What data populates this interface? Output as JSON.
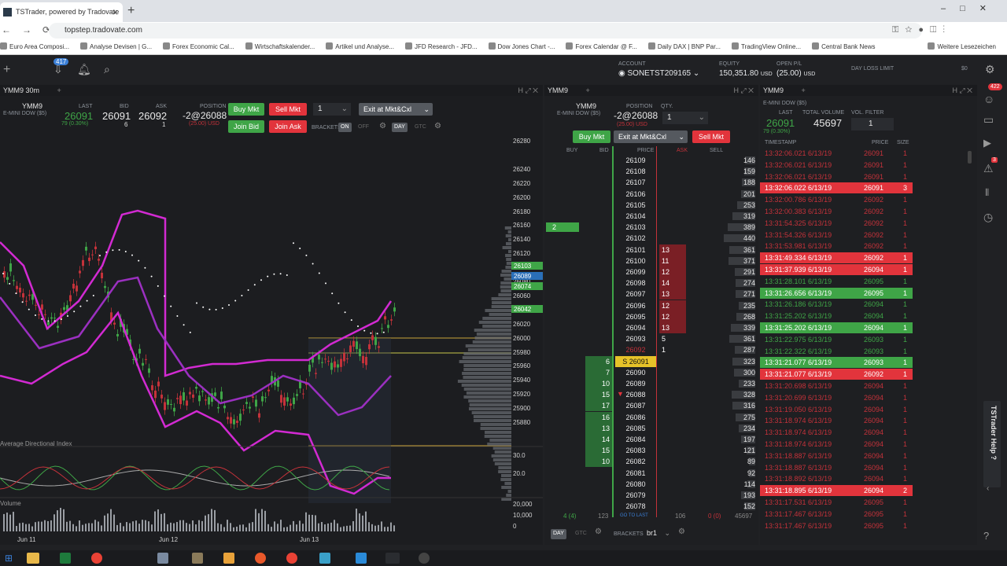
{
  "browser": {
    "tab_title": "TSTrader, powered by Tradovate",
    "url": "topstep.tradovate.com",
    "bookmarks": [
      "Euro Area Composi...",
      "Analyse Devisen | G...",
      "Forex Economic Cal...",
      "Wirtschaftskalender...",
      "Artikel und Analyse...",
      "JFD Research - JFD...",
      "Dow Jones Chart -...",
      "Forex Calendar @ F...",
      "Daily DAX | BNP Par...",
      "TradingView Online...",
      "Central Bank News",
      "Weitere Lesezeichen"
    ],
    "notification_count": "417"
  },
  "account": {
    "account_label": "ACCOUNT",
    "account_value": "SONETST209165",
    "equity_label": "EQUITY",
    "equity_value": "150,351.80",
    "equity_unit": "USD",
    "openpl_label": "OPEN P/L",
    "openpl_value": "(25.00)",
    "openpl_unit": "USD",
    "daylimit_label": "DAY LOSS LIMIT",
    "daylimit_value": "$0"
  },
  "chart_panel": {
    "tab": "YMM9 30m",
    "symbol": "YMM9",
    "symbol_desc": "E-MINI DOW ($5)",
    "last_label": "LAST",
    "last": "26091",
    "change": "79 (0.30%)",
    "bid_label": "BID",
    "bid": "26091",
    "bid_size": "6",
    "ask_label": "ASK",
    "ask": "26092",
    "ask_size": "1",
    "position_label": "POSITION",
    "position": "-2@26088",
    "position_pl": "(25.00) USD",
    "buy_mkt": "Buy Mkt",
    "sell_mkt": "Sell Mkt",
    "join_bid": "Join Bid",
    "join_ask": "Join Ask",
    "qty": "1",
    "exit": "Exit at Mkt&Cxl",
    "brackets": "BRACKETS",
    "on": "ON",
    "off": "OFF",
    "day": "DAY",
    "gtc": "GTC",
    "adx_label": "Average Directional Index",
    "volume_label": "Volume",
    "dates": [
      "Jun 11",
      "Jun 12",
      "Jun 13"
    ],
    "price_axis": [
      "26280",
      "26240",
      "26220",
      "26200",
      "26180",
      "26160",
      "26140",
      "26120",
      "26100",
      "26080",
      "26060",
      "26040",
      "26020",
      "26000",
      "25980",
      "25960",
      "25940",
      "25920",
      "25900",
      "25880"
    ],
    "price_tags": [
      {
        "value": "26103",
        "color": "#3fa547"
      },
      {
        "value": "26089",
        "color": "#2a6fb8"
      },
      {
        "value": "26074",
        "color": "#3fa547"
      },
      {
        "value": "26042",
        "color": "#3fa547"
      }
    ],
    "adx_axis": [
      "30.0",
      "20.0"
    ],
    "volume_axis": [
      "20,000",
      "10,000",
      "0"
    ]
  },
  "dom_panel": {
    "tab": "YMM9",
    "symbol": "YMM9",
    "symbol_desc": "E-MINI DOW ($5)",
    "position_label": "POSITION",
    "position": "-2@26088",
    "position_pl": "(25.00) USD",
    "qty_label": "QTY.",
    "qty": "1",
    "buy_mkt": "Buy Mkt",
    "exit": "Exit at Mkt&Cxl",
    "sell_mkt": "Sell Mkt",
    "col_buy": "BUY",
    "col_bid": "BID",
    "col_price": "PRICE",
    "col_ask": "ASK",
    "col_sell": "SELL",
    "rows": [
      {
        "price": "26109",
        "bid": "",
        "ask": "",
        "sell": "146"
      },
      {
        "price": "26108",
        "bid": "",
        "ask": "",
        "sell": "159"
      },
      {
        "price": "26107",
        "bid": "",
        "ask": "",
        "sell": "188"
      },
      {
        "price": "26106",
        "bid": "",
        "ask": "",
        "sell": "201"
      },
      {
        "price": "26105",
        "bid": "",
        "ask": "",
        "sell": "253"
      },
      {
        "price": "26104",
        "bid": "",
        "ask": "",
        "sell": "319"
      },
      {
        "price": "26103",
        "bid": "",
        "ask": "",
        "sell": "389",
        "buy": "2"
      },
      {
        "price": "26102",
        "bid": "",
        "ask": "",
        "sell": "440"
      },
      {
        "price": "26101",
        "bid": "",
        "ask": "13",
        "sell": "361"
      },
      {
        "price": "26100",
        "bid": "",
        "ask": "11",
        "sell": "371"
      },
      {
        "price": "26099",
        "bid": "",
        "ask": "12",
        "sell": "291"
      },
      {
        "price": "26098",
        "bid": "",
        "ask": "14",
        "sell": "274"
      },
      {
        "price": "26097",
        "bid": "",
        "ask": "13",
        "sell": "271"
      },
      {
        "price": "26096",
        "bid": "",
        "ask": "12",
        "sell": "235"
      },
      {
        "price": "26095",
        "bid": "",
        "ask": "12",
        "sell": "268"
      },
      {
        "price": "26094",
        "bid": "",
        "ask": "13",
        "sell": "339"
      },
      {
        "price": "26093",
        "bid": "",
        "ask": "5",
        "sell": "361"
      },
      {
        "price": "26092",
        "bid": "",
        "ask": "1",
        "sell": "287"
      },
      {
        "price": "S 26091",
        "bid": "6",
        "ask": "",
        "sell": "323"
      },
      {
        "price": "26090",
        "bid": "7",
        "ask": "",
        "sell": "300"
      },
      {
        "price": "26089",
        "bid": "10",
        "ask": "",
        "sell": "233"
      },
      {
        "price": "26088",
        "bid": "15",
        "ask": "",
        "sell": "328"
      },
      {
        "price": "26087",
        "bid": "17",
        "ask": "",
        "sell": "316"
      },
      {
        "price": "26086",
        "bid": "16",
        "ask": "",
        "sell": "275"
      },
      {
        "price": "26085",
        "bid": "13",
        "ask": "",
        "sell": "234"
      },
      {
        "price": "26084",
        "bid": "14",
        "ask": "",
        "sell": "197"
      },
      {
        "price": "26083",
        "bid": "15",
        "ask": "",
        "sell": "121"
      },
      {
        "price": "26082",
        "bid": "10",
        "ask": "",
        "sell": "89"
      },
      {
        "price": "26081",
        "bid": "",
        "ask": "",
        "sell": "92"
      },
      {
        "price": "26080",
        "bid": "",
        "ask": "",
        "sell": "114"
      },
      {
        "price": "26079",
        "bid": "",
        "ask": "",
        "sell": "193"
      },
      {
        "price": "26078",
        "bid": "",
        "ask": "",
        "sell": "152"
      }
    ],
    "footer_buy": "4 (4)",
    "footer_bid": "123",
    "footer_goto": "GO TO LAST",
    "footer_ask": "106",
    "footer_sell": "0 (0)",
    "footer_vol": "45697",
    "day": "DAY",
    "gtc": "GTC",
    "brackets": "BRACKETS",
    "bracket_value": "br1"
  },
  "ts_panel": {
    "tab": "YMM9",
    "symbol_desc": "E-MINI DOW ($5)",
    "last_label": "LAST",
    "last": "26091",
    "change": "79 (0.30%)",
    "volume_label": "TOTAL VOLUME",
    "volume": "45697",
    "filter_label": "VOL. FILTER",
    "filter": "1",
    "col_time": "TIMESTAMP",
    "col_price": "PRICE",
    "col_size": "SIZE",
    "rows": [
      {
        "t": "13:32:06.021 6/13/19",
        "p": "26091",
        "s": "1",
        "k": "red-t"
      },
      {
        "t": "13:32:06.021 6/13/19",
        "p": "26091",
        "s": "1",
        "k": "red-t"
      },
      {
        "t": "13:32:06.021 6/13/19",
        "p": "26091",
        "s": "1",
        "k": "red-t"
      },
      {
        "t": "13:32:06.022 6/13/19",
        "p": "26091",
        "s": "3",
        "k": "hl-red"
      },
      {
        "t": "13:32:00.786 6/13/19",
        "p": "26092",
        "s": "1",
        "k": "red-t"
      },
      {
        "t": "13:32:00.383 6/13/19",
        "p": "26092",
        "s": "1",
        "k": "red-t"
      },
      {
        "t": "13:31:54.325 6/13/19",
        "p": "26092",
        "s": "1",
        "k": "red-t"
      },
      {
        "t": "13:31:54.326 6/13/19",
        "p": "26092",
        "s": "1",
        "k": "red-t"
      },
      {
        "t": "13:31:53.981 6/13/19",
        "p": "26092",
        "s": "1",
        "k": "red-t"
      },
      {
        "t": "13:31:49.334 6/13/19",
        "p": "26092",
        "s": "1",
        "k": "hl-red"
      },
      {
        "t": "13:31:37.939 6/13/19",
        "p": "26094",
        "s": "1",
        "k": "hl-red"
      },
      {
        "t": "13:31:28.101 6/13/19",
        "p": "26095",
        "s": "1",
        "k": "green-t"
      },
      {
        "t": "13:31:26.656 6/13/19",
        "p": "26095",
        "s": "1",
        "k": "hl-green"
      },
      {
        "t": "13:31:26.186 6/13/19",
        "p": "26094",
        "s": "1",
        "k": "green-t"
      },
      {
        "t": "13:31:25.202 6/13/19",
        "p": "26094",
        "s": "1",
        "k": "green-t"
      },
      {
        "t": "13:31:25.202 6/13/19",
        "p": "26094",
        "s": "1",
        "k": "hl-green"
      },
      {
        "t": "13:31:22.975 6/13/19",
        "p": "26093",
        "s": "1",
        "k": "green-t"
      },
      {
        "t": "13:31:22.322 6/13/19",
        "p": "26093",
        "s": "1",
        "k": "green-t"
      },
      {
        "t": "13:31:21.077 6/13/19",
        "p": "26093",
        "s": "1",
        "k": "hl-green"
      },
      {
        "t": "13:31:21.077 6/13/19",
        "p": "26092",
        "s": "1",
        "k": "hl-red"
      },
      {
        "t": "13:31:20.698 6/13/19",
        "p": "26094",
        "s": "1",
        "k": "red-t"
      },
      {
        "t": "13:31:20.699 6/13/19",
        "p": "26094",
        "s": "1",
        "k": "red-t"
      },
      {
        "t": "13:31:19.050 6/13/19",
        "p": "26094",
        "s": "1",
        "k": "red-t"
      },
      {
        "t": "13:31:18.974 6/13/19",
        "p": "26094",
        "s": "1",
        "k": "red-t"
      },
      {
        "t": "13:31:18.974 6/13/19",
        "p": "26094",
        "s": "1",
        "k": "red-t"
      },
      {
        "t": "13:31:18.974 6/13/19",
        "p": "26094",
        "s": "1",
        "k": "red-t"
      },
      {
        "t": "13:31:18.887 6/13/19",
        "p": "26094",
        "s": "1",
        "k": "red-t"
      },
      {
        "t": "13:31:18.887 6/13/19",
        "p": "26094",
        "s": "1",
        "k": "red-t"
      },
      {
        "t": "13:31:18.892 6/13/19",
        "p": "26094",
        "s": "1",
        "k": "red-t"
      },
      {
        "t": "13:31:18.895 6/13/19",
        "p": "26094",
        "s": "2",
        "k": "hl-red"
      },
      {
        "t": "13:31:17.531 6/13/19",
        "p": "26095",
        "s": "1",
        "k": "red-t"
      },
      {
        "t": "13:31:17.467 6/13/19",
        "p": "26095",
        "s": "1",
        "k": "red-t"
      },
      {
        "t": "13:31:17.467 6/13/19",
        "p": "26095",
        "s": "1",
        "k": "red-t"
      }
    ]
  },
  "sidebar": {
    "badge_top": "422",
    "badge_alert": "3",
    "help_label": "TSTrader Help ?"
  }
}
